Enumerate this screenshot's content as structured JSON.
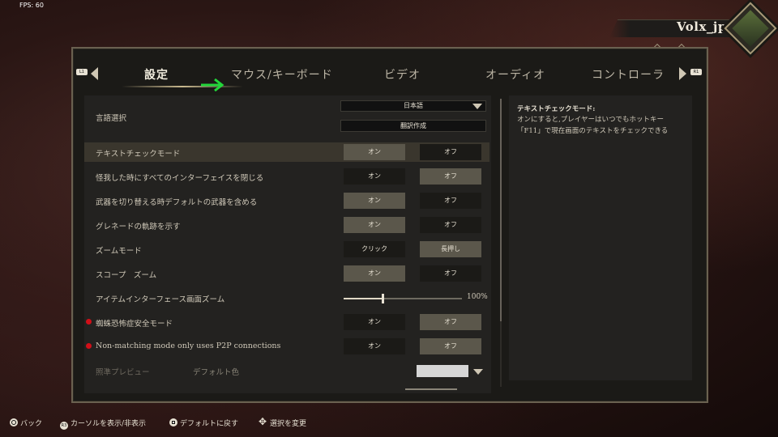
{
  "hud": {
    "fps": "FPS: 60"
  },
  "player": {
    "name": "Volx_jp"
  },
  "tabs": {
    "lb": "L1",
    "rb": "R1",
    "items": [
      {
        "label": "設定",
        "active": true
      },
      {
        "label": "マウス/キーボード"
      },
      {
        "label": "ビデオ"
      },
      {
        "label": "オーディオ"
      },
      {
        "label": "コントローラ"
      }
    ]
  },
  "settings": {
    "language": {
      "label": "言語選択",
      "value": "日本語",
      "translate_button": "翻訳作成"
    },
    "rows": [
      {
        "label": "テキストチェックモード",
        "a": "オン",
        "b": "オフ",
        "selected": "a",
        "highlight": true
      },
      {
        "label": "怪我した時にすべてのインターフェイスを閉じる",
        "a": "オン",
        "b": "オフ",
        "selected": "b"
      },
      {
        "label": "武器を切り替える時デフォルトの武器を含める",
        "a": "オン",
        "b": "オフ",
        "selected": "a"
      },
      {
        "label": "グレネードの軌跡を示す",
        "a": "オン",
        "b": "オフ",
        "selected": "a"
      },
      {
        "label": "ズームモード",
        "a": "クリック",
        "b": "長押し",
        "selected": "b"
      },
      {
        "label": "スコープ　ズーム",
        "a": "オン",
        "b": "オフ",
        "selected": "a"
      }
    ],
    "zoom_slider": {
      "label": "アイテムインターフェース画面ズーム",
      "value_text": "100%",
      "fraction": 0.33
    },
    "red_rows": [
      {
        "label": "蜘蛛恐怖症安全モード",
        "a": "オン",
        "b": "オフ",
        "selected": "b"
      },
      {
        "label": "Non-matching mode only uses P2P connections",
        "a": "オン",
        "b": "オフ",
        "selected": "b"
      }
    ],
    "preview": {
      "label": "照準プレビュー",
      "sub": "デフォルト色",
      "swatch_color": "#d6d6d6"
    }
  },
  "description": {
    "title": "テキストチェックモード:",
    "body": "オンにすると,プレイヤーはいつでもホットキー「F11」で現在画面のテキストをチェックできる"
  },
  "footer": {
    "back": "バック",
    "cursor_toggle": "カーソルを表示/非表示",
    "reset_default": "デフォルトに戻す",
    "change_selection": "選択を変更",
    "r3_glyph": "R3"
  },
  "colors": {
    "accent_arrow": "#22d63a",
    "alert_dot": "#d10f18"
  }
}
